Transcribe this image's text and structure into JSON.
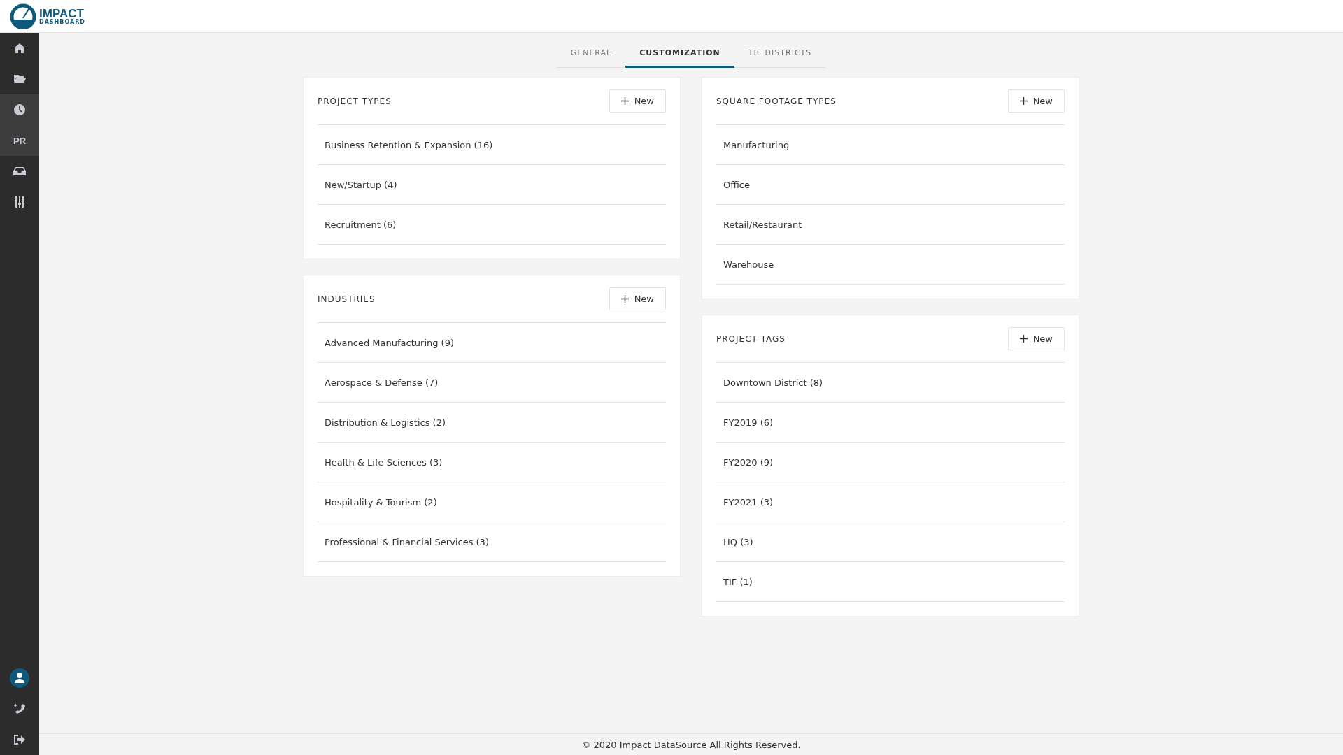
{
  "header": {
    "logo_title": "IMPACT",
    "logo_subtitle": "DASHBOARD"
  },
  "sidebar": {
    "items": [
      {
        "kind": "home",
        "selected": false
      },
      {
        "kind": "folder",
        "selected": false
      },
      {
        "kind": "clock",
        "selected": true
      },
      {
        "kind": "text",
        "label": "PR",
        "selected": true
      },
      {
        "kind": "inbox",
        "selected": false
      },
      {
        "kind": "sliders",
        "selected": false
      }
    ],
    "bottom_items": [
      {
        "kind": "user"
      },
      {
        "kind": "phone"
      },
      {
        "kind": "logout"
      }
    ]
  },
  "tabs": [
    {
      "label": "GENERAL",
      "selected": false
    },
    {
      "label": "CUSTOMIZATION",
      "selected": true
    },
    {
      "label": "TIF DISTRICTS",
      "selected": false
    }
  ],
  "columns": [
    [
      {
        "title": "PROJECT TYPES",
        "button": "New",
        "items": [
          "Business Retention & Expansion (16)",
          "New/Startup (4)",
          "Recruitment (6)"
        ]
      },
      {
        "title": "INDUSTRIES",
        "button": "New",
        "items": [
          "Advanced Manufacturing (9)",
          "Aerospace & Defense (7)",
          "Distribution & Logistics (2)",
          "Health & Life Sciences (3)",
          "Hospitality & Tourism (2)",
          "Professional & Financial Services (3)"
        ]
      }
    ],
    [
      {
        "title": "SQUARE FOOTAGE TYPES",
        "button": "New",
        "items": [
          "Manufacturing",
          "Office",
          "Retail/Restaurant",
          "Warehouse"
        ]
      },
      {
        "title": "PROJECT TAGS",
        "button": "New",
        "items": [
          "Downtown District (8)",
          "FY2019 (6)",
          "FY2020 (9)",
          "FY2021 (3)",
          "HQ (3)",
          "TIF (1)"
        ]
      }
    ]
  ],
  "footer": "© 2020 Impact DataSource All Rights Reserved."
}
